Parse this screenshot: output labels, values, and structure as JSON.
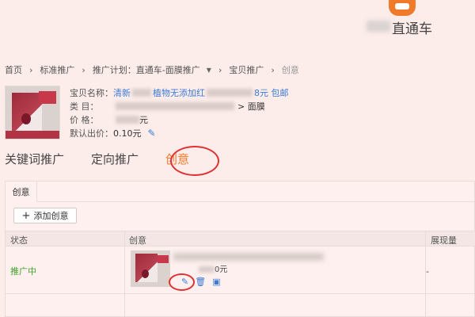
{
  "header": {
    "logo_text": "直通车"
  },
  "breadcrumb": {
    "items": [
      "首页",
      "标准推广",
      "推广计划：直通车-面膜推广",
      "宝贝推广",
      "创意"
    ]
  },
  "product": {
    "name_label": "宝贝名称：",
    "name_value_start": "清新",
    "name_value_mid": "植物无添加红",
    "name_value_end": "8元 包邮",
    "category_label": "类 目：",
    "category_value_end": "> 面膜",
    "price_label": "价 格：",
    "price_value_end": "元",
    "default_bid_label": "默认出价：",
    "default_bid_value": "0.10元"
  },
  "tabs": {
    "keyword": "关键词推广",
    "targeted": "定向推广",
    "creative": "创意"
  },
  "panel": {
    "subtab": "创意",
    "add_button": "添加创意",
    "columns": [
      "状态",
      "创意",
      "展现量"
    ],
    "rows": [
      {
        "status": "推广中",
        "price_suffix": "0元",
        "impressions": "-"
      }
    ]
  },
  "colors": {
    "accent": "#f07a2a",
    "link": "#3a7bd5",
    "status_active": "#3f9f29",
    "highlight_circle": "#e03030"
  }
}
